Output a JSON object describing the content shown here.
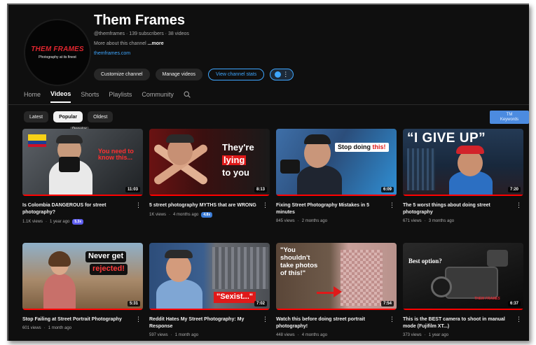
{
  "channel": {
    "name": "Them Frames",
    "handle": "@themframes",
    "subscribers": "139 subscribers",
    "videos_count": "38 videos",
    "about": "More about this channel",
    "about_more": "...more",
    "link": "themframes.com",
    "logo_title": "THEM FRAMES",
    "logo_subtitle": "Photography at its finest"
  },
  "actions": {
    "customize": "Customize channel",
    "manage": "Manage videos",
    "stats": "View channel stats"
  },
  "tabs": [
    "Home",
    "Videos",
    "Shorts",
    "Playlists",
    "Community"
  ],
  "active_tab": "Videos",
  "chips": [
    "Latest",
    "Popular",
    "Oldest"
  ],
  "active_chip": "Popular",
  "tooltip": "Popular",
  "keywords_button": {
    "line1": "TM",
    "line2": "Keywords"
  },
  "colors": {
    "background": "#0f0f0f",
    "accent_blue": "#3ea6ff",
    "progress_red": "#ff0000",
    "badge_purple": "#5f5ff0"
  },
  "videos": [
    {
      "title": "Is Colombia DANGEROUS for street photography?",
      "views": "1.1K views",
      "age": "1 year ago",
      "badge": "5.3x",
      "duration": "11:03",
      "thumb_text": "You need to know this...",
      "thumb_text_color": "#ff3030"
    },
    {
      "title": "5 street photography MYTHS that are WRONG",
      "views": "1K views",
      "age": "4 months ago",
      "badge": "4.8x",
      "duration": "8:13",
      "thumb_text_1": "They're",
      "thumb_text_2": "lying",
      "thumb_text_3": "to you"
    },
    {
      "title": "Fixing Street Photography Mistakes in 5 minutes",
      "views": "845 views",
      "age": "2 months ago",
      "badge": "",
      "duration": "6:09",
      "thumb_text_1": "Stop doing ",
      "thumb_text_2": "this!"
    },
    {
      "title": "The 5 worst things about doing street photography",
      "views": "671 views",
      "age": "3 months ago",
      "badge": "",
      "duration": "7:20",
      "thumb_text": "“I GIVE UP”"
    },
    {
      "title": "Stop Failing at Street Portrait Photography",
      "views": "601 views",
      "age": "1 month ago",
      "badge": "",
      "duration": "5:31",
      "thumb_text_1": "Never get",
      "thumb_text_2": "rejected!"
    },
    {
      "title": "Reddit Hates My Street Photography: My Response",
      "views": "597 views",
      "age": "1 month ago",
      "badge": "",
      "duration": "7:02",
      "thumb_text": "\"Sexist...\""
    },
    {
      "title": "Watch this before doing street portrait photography!",
      "views": "448 views",
      "age": "4 months ago",
      "badge": "",
      "duration": "7:54",
      "thumb_text": "\"You shouldn't take photos of this!\""
    },
    {
      "title": "This is the BEST camera to shoot in manual mode (Fujifilm XT...)",
      "views": "373 views",
      "age": "1 year ago",
      "badge": "",
      "duration": "6:37",
      "thumb_text": "Best option?",
      "thumb_logo": "THEM FRAMES"
    }
  ]
}
